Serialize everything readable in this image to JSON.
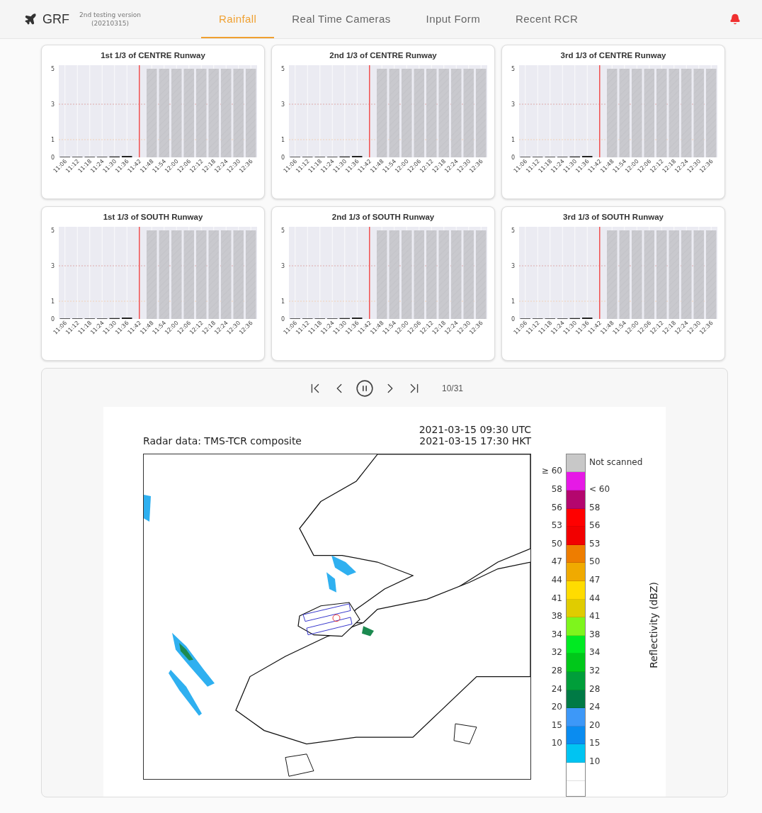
{
  "header": {
    "brand": "GRF",
    "version_lines": [
      "2nd testing version",
      "(20210315)"
    ],
    "tabs": [
      {
        "label": "Rainfall",
        "selected": true
      },
      {
        "label": "Real Time Cameras",
        "selected": false
      },
      {
        "label": "Input Form",
        "selected": false
      },
      {
        "label": "Recent RCR",
        "selected": false
      }
    ]
  },
  "charts": [
    {
      "title": "1st 1/3 of CENTRE Runway",
      "chart_data": {
        "type": "bar",
        "grid": true,
        "categories": [
          "11:06",
          "11:12",
          "11:18",
          "11:24",
          "11:30",
          "11:36",
          "11:42",
          "11:48",
          "11:54",
          "12:00",
          "12:06",
          "12:12",
          "12:18",
          "12:24",
          "12:30",
          "12:36"
        ],
        "yticks": [
          0,
          1,
          3,
          5
        ],
        "ylim": [
          0,
          5.2
        ],
        "series": [
          {
            "color": "#222222",
            "values": [
              0.03,
              0.03,
              0.03,
              0.03,
              0.05,
              0.08,
              null,
              null,
              null,
              null,
              null,
              null,
              null,
              null,
              null,
              null
            ]
          },
          {
            "color": "#c9c9ce",
            "values": [
              null,
              null,
              null,
              null,
              null,
              null,
              null,
              5,
              5,
              5,
              5,
              5,
              5,
              5,
              5,
              5
            ]
          }
        ],
        "ref_lines": [
          {
            "axis": "x",
            "value": "11:42",
            "color": "#f05050"
          },
          {
            "axis": "y",
            "value": 3,
            "color": "#d99a9a"
          },
          {
            "axis": "y",
            "value": 1,
            "color": "#f3c9a8"
          }
        ]
      }
    },
    {
      "title": "2nd 1/3 of CENTRE Runway",
      "chart_data": {
        "type": "bar",
        "grid": true,
        "categories": [
          "11:06",
          "11:12",
          "11:18",
          "11:24",
          "11:30",
          "11:36",
          "11:42",
          "11:48",
          "11:54",
          "12:00",
          "12:06",
          "12:12",
          "12:18",
          "12:24",
          "12:30",
          "12:36"
        ],
        "yticks": [
          0,
          1,
          3,
          5
        ],
        "ylim": [
          0,
          5.2
        ],
        "series": [
          {
            "color": "#222222",
            "values": [
              0.03,
              0.03,
              0.03,
              0.03,
              0.05,
              0.08,
              null,
              null,
              null,
              null,
              null,
              null,
              null,
              null,
              null,
              null
            ]
          },
          {
            "color": "#c9c9ce",
            "values": [
              null,
              null,
              null,
              null,
              null,
              null,
              null,
              5,
              5,
              5,
              5,
              5,
              5,
              5,
              5,
              5
            ]
          }
        ],
        "ref_lines": [
          {
            "axis": "x",
            "value": "11:42",
            "color": "#f05050"
          },
          {
            "axis": "y",
            "value": 3,
            "color": "#d99a9a"
          },
          {
            "axis": "y",
            "value": 1,
            "color": "#f3c9a8"
          }
        ]
      }
    },
    {
      "title": "3rd 1/3 of CENTRE Runway",
      "chart_data": {
        "type": "bar",
        "grid": true,
        "categories": [
          "11:06",
          "11:12",
          "11:18",
          "11:24",
          "11:30",
          "11:36",
          "11:42",
          "11:48",
          "11:54",
          "12:00",
          "12:06",
          "12:12",
          "12:18",
          "12:24",
          "12:30",
          "12:36"
        ],
        "yticks": [
          0,
          1,
          3,
          5
        ],
        "ylim": [
          0,
          5.2
        ],
        "series": [
          {
            "color": "#222222",
            "values": [
              0.03,
              0.03,
              0.03,
              0.03,
              0.05,
              0.08,
              null,
              null,
              null,
              null,
              null,
              null,
              null,
              null,
              null,
              null
            ]
          },
          {
            "color": "#c9c9ce",
            "values": [
              null,
              null,
              null,
              null,
              null,
              null,
              null,
              5,
              5,
              5,
              5,
              5,
              5,
              5,
              5,
              5
            ]
          }
        ],
        "ref_lines": [
          {
            "axis": "x",
            "value": "11:42",
            "color": "#f05050"
          },
          {
            "axis": "y",
            "value": 3,
            "color": "#d99a9a"
          },
          {
            "axis": "y",
            "value": 1,
            "color": "#f3c9a8"
          }
        ]
      }
    },
    {
      "title": "1st 1/3 of SOUTH Runway",
      "chart_data": {
        "type": "bar",
        "grid": true,
        "categories": [
          "11:06",
          "11:12",
          "11:18",
          "11:24",
          "11:30",
          "11:36",
          "11:42",
          "11:48",
          "11:54",
          "12:00",
          "12:06",
          "12:12",
          "12:18",
          "12:24",
          "12:30",
          "12:36"
        ],
        "yticks": [
          0,
          1,
          3,
          5
        ],
        "ylim": [
          0,
          5.2
        ],
        "series": [
          {
            "color": "#222222",
            "values": [
              0.03,
              0.03,
              0.03,
              0.03,
              0.05,
              0.08,
              null,
              null,
              null,
              null,
              null,
              null,
              null,
              null,
              null,
              null
            ]
          },
          {
            "color": "#c9c9ce",
            "values": [
              null,
              null,
              null,
              null,
              null,
              null,
              null,
              5,
              5,
              5,
              5,
              5,
              5,
              5,
              5,
              5
            ]
          }
        ],
        "ref_lines": [
          {
            "axis": "x",
            "value": "11:42",
            "color": "#f05050"
          },
          {
            "axis": "y",
            "value": 3,
            "color": "#d99a9a"
          },
          {
            "axis": "y",
            "value": 1,
            "color": "#f3c9a8"
          }
        ]
      }
    },
    {
      "title": "2nd 1/3 of SOUTH Runway",
      "chart_data": {
        "type": "bar",
        "grid": true,
        "categories": [
          "11:06",
          "11:12",
          "11:18",
          "11:24",
          "11:30",
          "11:36",
          "11:42",
          "11:48",
          "11:54",
          "12:00",
          "12:06",
          "12:12",
          "12:18",
          "12:24",
          "12:30",
          "12:36"
        ],
        "yticks": [
          0,
          1,
          3,
          5
        ],
        "ylim": [
          0,
          5.2
        ],
        "series": [
          {
            "color": "#222222",
            "values": [
              0.03,
              0.03,
              0.03,
              0.03,
              0.05,
              0.08,
              null,
              null,
              null,
              null,
              null,
              null,
              null,
              null,
              null,
              null
            ]
          },
          {
            "color": "#c9c9ce",
            "values": [
              null,
              null,
              null,
              null,
              null,
              null,
              null,
              5,
              5,
              5,
              5,
              5,
              5,
              5,
              5,
              5
            ]
          }
        ],
        "ref_lines": [
          {
            "axis": "x",
            "value": "11:42",
            "color": "#f05050"
          },
          {
            "axis": "y",
            "value": 3,
            "color": "#d99a9a"
          },
          {
            "axis": "y",
            "value": 1,
            "color": "#f3c9a8"
          }
        ]
      }
    },
    {
      "title": "3rd 1/3 of SOUTH Runway",
      "chart_data": {
        "type": "bar",
        "grid": true,
        "categories": [
          "11:06",
          "11:12",
          "11:18",
          "11:24",
          "11:30",
          "11:36",
          "11:42",
          "11:48",
          "11:54",
          "12:00",
          "12:06",
          "12:12",
          "12:18",
          "12:24",
          "12:30",
          "12:36"
        ],
        "yticks": [
          0,
          1,
          3,
          5
        ],
        "ylim": [
          0,
          5.2
        ],
        "series": [
          {
            "color": "#222222",
            "values": [
              0.03,
              0.03,
              0.03,
              0.03,
              0.05,
              0.08,
              null,
              null,
              null,
              null,
              null,
              null,
              null,
              null,
              null,
              null
            ]
          },
          {
            "color": "#c9c9ce",
            "values": [
              null,
              null,
              null,
              null,
              null,
              null,
              null,
              5,
              5,
              5,
              5,
              5,
              5,
              5,
              5,
              5
            ]
          }
        ],
        "ref_lines": [
          {
            "axis": "x",
            "value": "11:42",
            "color": "#f05050"
          },
          {
            "axis": "y",
            "value": 3,
            "color": "#d99a9a"
          },
          {
            "axis": "y",
            "value": 1,
            "color": "#f3c9a8"
          }
        ]
      }
    }
  ],
  "player": {
    "playing": true,
    "counter": "10/31"
  },
  "radar": {
    "title": "Radar data: TMS-TCR composite",
    "times": [
      "2021-03-15 09:30 UTC",
      "2021-03-15 17:30 HKT"
    ],
    "map": {
      "kind": "picture"
    },
    "axis_label": "Reflectivity (dBZ)",
    "segments": [
      {
        "color": "#c8c8c8",
        "right_label": "Not scanned"
      },
      {
        "color": "#e619e6",
        "left_label": "≥ 60"
      },
      {
        "color": "#b4066e",
        "left_label": "58",
        "right_label": "< 60"
      },
      {
        "color": "#ff0000",
        "left_label": "56",
        "right_label": "58"
      },
      {
        "color": "#f20000",
        "left_label": "53",
        "right_label": "56"
      },
      {
        "color": "#ee7d00",
        "left_label": "50",
        "right_label": "53"
      },
      {
        "color": "#f0aa00",
        "left_label": "47",
        "right_label": "50"
      },
      {
        "color": "#ffdc00",
        "left_label": "44",
        "right_label": "47"
      },
      {
        "color": "#e0cc00",
        "left_label": "41",
        "right_label": "44"
      },
      {
        "color": "#7ef51c",
        "left_label": "38",
        "right_label": "41"
      },
      {
        "color": "#00ea22",
        "left_label": "34",
        "right_label": "38"
      },
      {
        "color": "#00c81a",
        "left_label": "32",
        "right_label": "34"
      },
      {
        "color": "#009e3a",
        "left_label": "28",
        "right_label": "32"
      },
      {
        "color": "#007a45",
        "left_label": "24",
        "right_label": "28"
      },
      {
        "color": "#3d98f8",
        "left_label": "20",
        "right_label": "24"
      },
      {
        "color": "#0a8cf0",
        "left_label": "15",
        "right_label": "20"
      },
      {
        "color": "#00c4f2",
        "left_label": "10",
        "right_label": "15"
      },
      {
        "color": "#ffffff",
        "right_label": "10"
      }
    ]
  }
}
